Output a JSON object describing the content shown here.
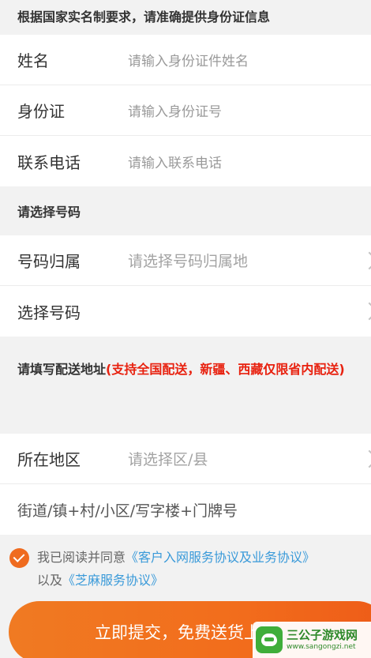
{
  "notice": {
    "text": "根据国家实名制要求，请准确提供身份证信息"
  },
  "identity": {
    "name_label": "姓名",
    "name_placeholder": "请输入身份证件姓名",
    "id_label": "身份证",
    "id_placeholder": "请输入身份证号",
    "phone_label": "联系电话",
    "phone_placeholder": "请输入联系电话"
  },
  "number_section": {
    "header": "请选择号码",
    "region_label": "号码归属",
    "region_placeholder": "请选择号码归属地",
    "select_label": "选择号码"
  },
  "address_section": {
    "header_main": "请填写配送地址",
    "header_note": "(支持全国配送，新疆、西藏仅限省内配送)",
    "area_label": "所在地区",
    "area_placeholder": "请选择区/县",
    "street_placeholder": "街道/镇+村/小区/写字楼+门牌号"
  },
  "agreement": {
    "prefix": "我已阅读并同意",
    "link1": "《客户入网服务协议及业务协议》",
    "middle": "以及",
    "link2": "《芝麻服务协议》",
    "checked": true
  },
  "submit": {
    "label": "立即提交，免费送货上门"
  },
  "watermark": {
    "title": "三公子游戏网",
    "url": "www.sangongzi.net"
  },
  "colors": {
    "accent": "#f07a22",
    "warning": "#e8210f",
    "link": "#3a9ad9",
    "background": "#f2f2f2"
  }
}
